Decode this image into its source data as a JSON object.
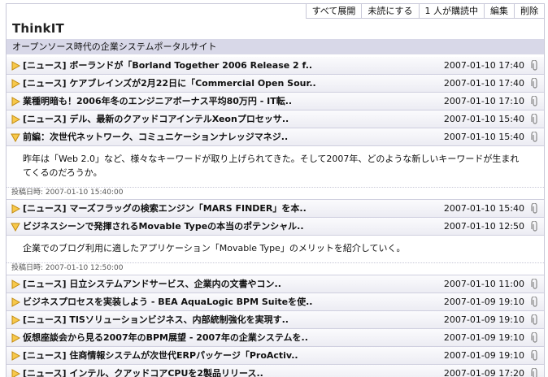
{
  "toolbar": {
    "expand_all": "すべて展開",
    "mark_unread": "未読にする",
    "subscribers": "1 人が購読中",
    "edit": "編集",
    "delete": "削除"
  },
  "feed": {
    "title": "ThinkIT",
    "description": "オープンソース時代の企業システムポータルサイト"
  },
  "entries": [
    {
      "title": "[ニュース] ボーランドが「Borland Together 2006 Release 2 f..",
      "date": "2007-01-10 17:40",
      "expanded": false
    },
    {
      "title": "[ニュース] ケアブレインズが2月22日に「Commercial Open Sour..",
      "date": "2007-01-10 17:40",
      "expanded": false
    },
    {
      "title": "業種明暗も！2006年冬のエンジニアボーナス平均80万円 - IT転..",
      "date": "2007-01-10 17:10",
      "expanded": false
    },
    {
      "title": "[ニュース] デル、最新のクアッドコアインテルXeonプロセッサ..",
      "date": "2007-01-10 15:40",
      "expanded": false
    },
    {
      "title": "前編：次世代ネットワーク、コミュニケーションナレッジマネジ..",
      "date": "2007-01-10 15:40",
      "expanded": true,
      "summary": "昨年は「Web 2.0」など、様々なキーワードが取り上げられてきた。そして2007年、どのような新しいキーワードが生まれてくるのだろうか。",
      "posted": "投稿日時: 2007-01-10 15:40:00"
    },
    {
      "title": "[ニュース] マーズフラッグの検索エンジン「MARS FINDER」を本..",
      "date": "2007-01-10 15:40",
      "expanded": false
    },
    {
      "title": "ビジネスシーンで発揮されるMovable Typeの本当のポテンシャル..",
      "date": "2007-01-10 12:50",
      "expanded": true,
      "summary": "企業でのブログ利用に適したアプリケーション「Movable Type」のメリットを紹介していく。",
      "posted": "投稿日時: 2007-01-10 12:50:00"
    },
    {
      "title": "[ニュース] 日立システムアンドサービス、企業内の文書やコン..",
      "date": "2007-01-10 11:00",
      "expanded": false
    },
    {
      "title": "ビジネスプロセスを実装しよう - BEA AquaLogic BPM Suiteを使..",
      "date": "2007-01-09 19:10",
      "expanded": false
    },
    {
      "title": "[ニュース] TISソリューションビジネス、内部統制強化を実現す..",
      "date": "2007-01-09 19:10",
      "expanded": false
    },
    {
      "title": "仮想座談会から見る2007年のBPM展望 - 2007年の企業システムを..",
      "date": "2007-01-09 19:10",
      "expanded": false
    },
    {
      "title": "[ニュース] 住商情報システムが次世代ERPパッケージ「ProActiv..",
      "date": "2007-01-09 19:10",
      "expanded": false
    },
    {
      "title": "[ニュース] インテル、クアッドコアCPUを2製品リリース..",
      "date": "2007-01-09 17:20",
      "expanded": false
    }
  ],
  "colors": {
    "arrow_fill": "#f7c84a",
    "arrow_stroke": "#c08a10",
    "header_band": "#d8d8e8"
  }
}
